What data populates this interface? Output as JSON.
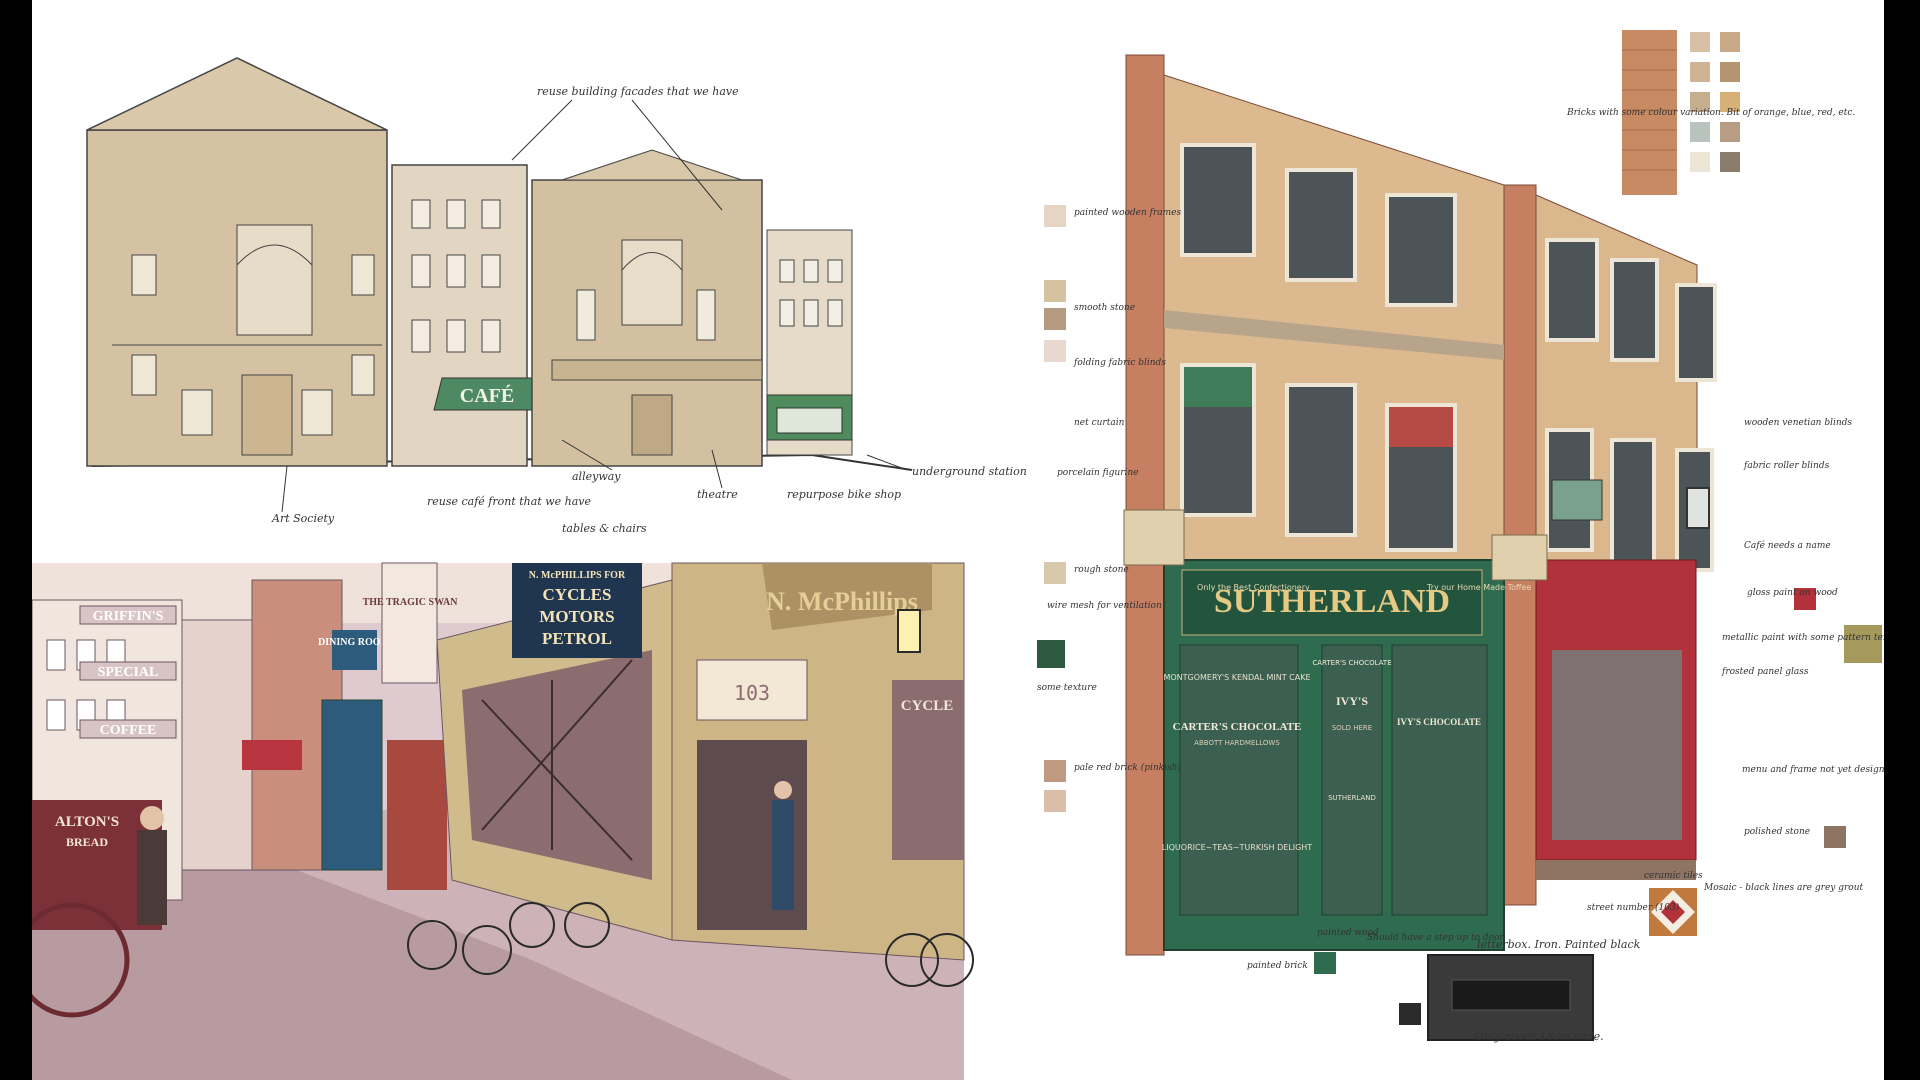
{
  "sketch": {
    "cafe_sign": "CAFÉ",
    "notes": {
      "reuse_facades": "reuse building facades that we have",
      "art_society": "Art Society",
      "reuse_cafe": "reuse café front that we have",
      "alleyway": "alleyway",
      "tables": "tables & chairs",
      "theatre": "theatre",
      "bike_shop": "repurpose bike shop",
      "underground": "underground station"
    }
  },
  "street_scene": {
    "signs": {
      "griffins": "GRIFFIN'S",
      "special": "SPECIAL",
      "coffee": "COFFEE",
      "tragic": "THE TRAGIC SWAN",
      "dining": "DINING ROOM",
      "mcphillips_small": "N. McPHILLIPS FOR",
      "cycles": "CYCLES",
      "motors": "MOTORS",
      "petrol": "PETROL",
      "mcphillips_big": "N. McPhillips",
      "number": "103",
      "cycles_right": "CYCLE",
      "alton": "ALTON'S",
      "bread": "BREAD"
    }
  },
  "shopfront": {
    "sutherland": "SUTHERLAND",
    "only_best": "Only the Best Confectionery",
    "try_home": "Try our Home Made Toffee",
    "montgomery": "MONTGOMERY'S KENDAL MINT CAKE",
    "carters": "CARTER'S CHOCOLATE",
    "carters_small": "CARTER'S CHOCOLATE",
    "ivys": "IVY'S",
    "sold_here": "SOLD HERE",
    "ivys_choc": "IVY'S CHOCOLATE",
    "abbott": "ABBOTT HARDMELLOWS",
    "liquorice": "LIQUORICE~TEAS~TURKISH DELIGHT",
    "door": "SUTHERLAND",
    "notes": {
      "bricks": "Bricks with some colour variation. Bit of orange, blue, red, etc.",
      "painted_wooden": "painted wooden frames",
      "smooth_stone": "smooth stone",
      "folding_blinds": "folding fabric blinds",
      "net_curtain": "net curtain",
      "porcelain": "porcelain figurine",
      "rough_stone": "rough stone",
      "wire_mesh": "wire mesh for ventilation",
      "some_texture": "some texture",
      "pale_red": "pale red brick (pinkish)",
      "painted_brick": "painted brick",
      "painted_wood": "painted wood",
      "step_door": "Should have a step up to door",
      "letterbox": "letterbox. Iron. Painted black",
      "only_18": "Only about 18cm wide.",
      "street_number": "street number (103)",
      "ceramic": "ceramic tiles",
      "mosaic": "Mosaic - black lines are grey grout",
      "polished": "polished stone",
      "menu": "menu and frame not yet designed",
      "frosted": "frosted panel glass",
      "metallic": "metallic paint with some pattern texture",
      "gloss": "gloss paint on wood",
      "cafe_name": "Café needs a name",
      "roller": "fabric roller blinds",
      "venetian": "wooden venetian blinds"
    }
  },
  "swatches": {
    "top": [
      "#d8bfa6",
      "#c9a888",
      "#cfb294",
      "#b5956f",
      "#c6ad8e",
      "#d7b078",
      "#b9c3bd",
      "#b89d85",
      "#ede6d6",
      "#8a7d6c"
    ],
    "side_left": [
      "#e6d4c5",
      "#d4c2a0",
      "#b39a80",
      "#e8d8cf",
      "#d8c9ab",
      "#2e5a41",
      "#c09981",
      "#dabea9",
      "#2f6b4f",
      "#2b2b2b"
    ],
    "side_right": [
      "#b2313a",
      "#a59a5c",
      "#8e7563"
    ]
  }
}
